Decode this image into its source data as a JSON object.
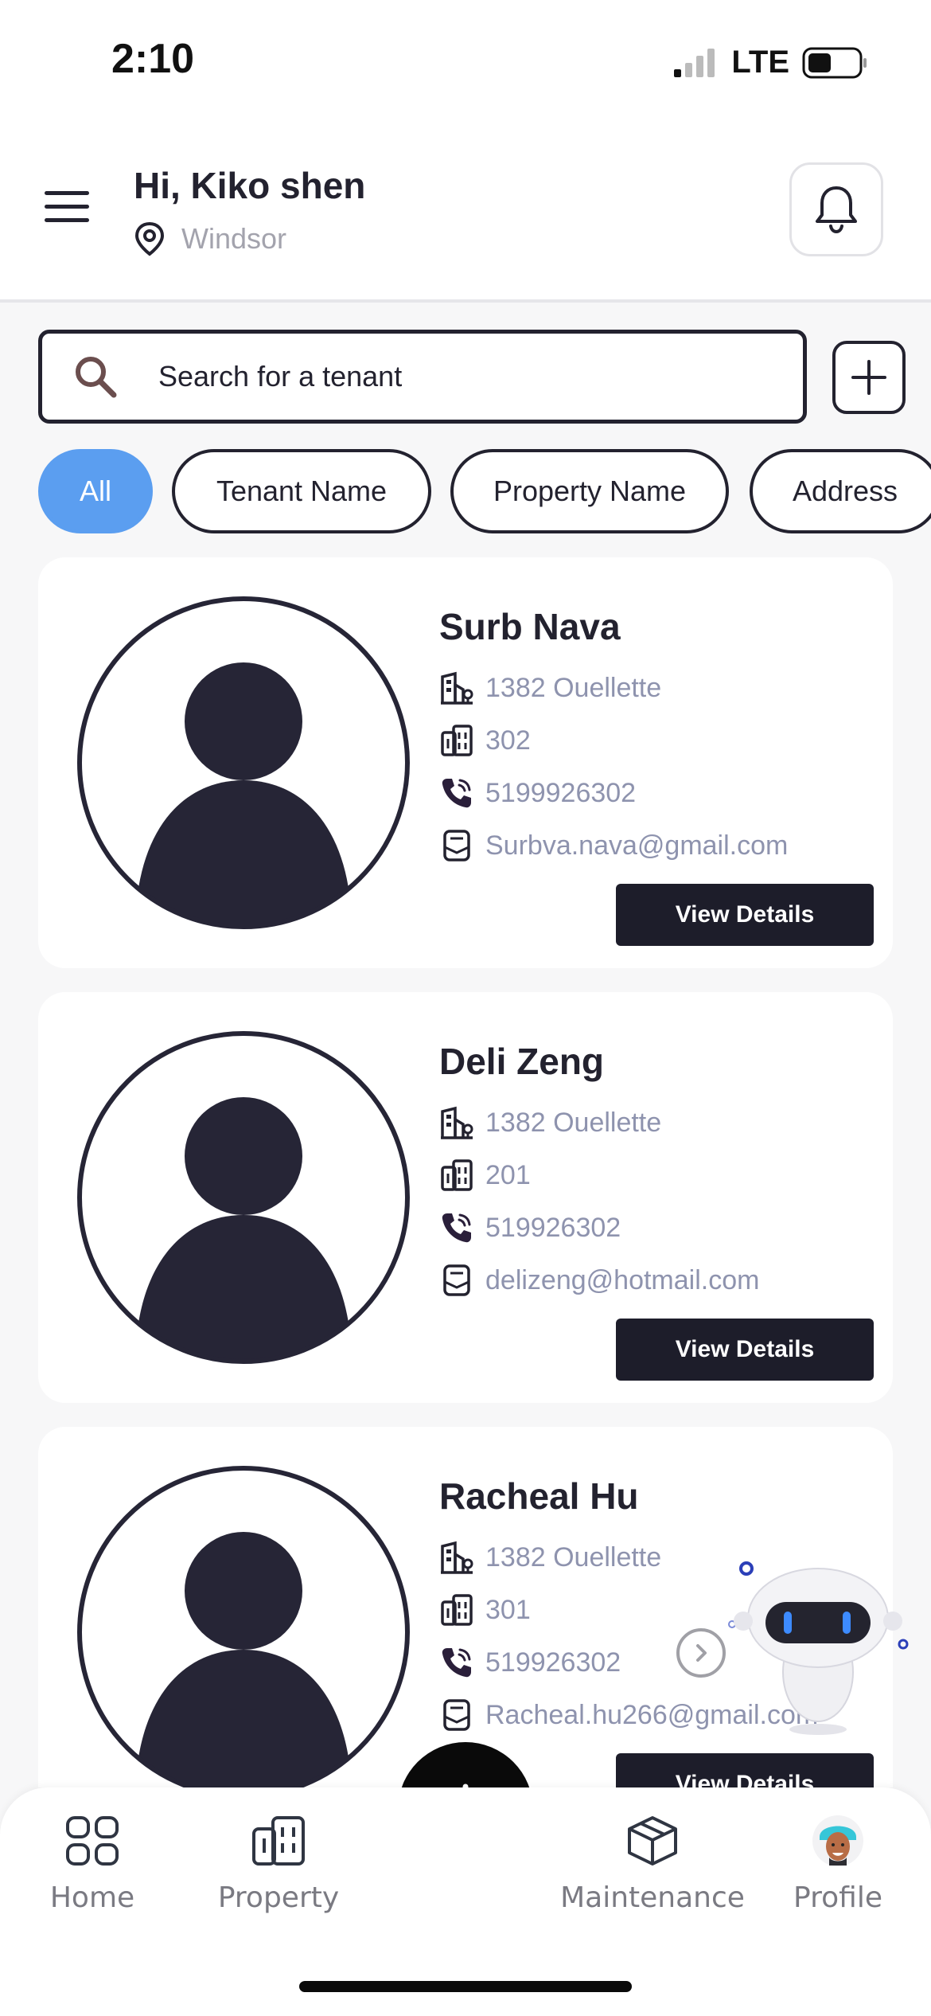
{
  "status": {
    "time": "2:10",
    "network": "LTE"
  },
  "header": {
    "greeting": "Hi, Kiko shen",
    "location": "Windsor"
  },
  "search": {
    "placeholder": "Search for a tenant"
  },
  "filters": [
    "All",
    "Tenant Name",
    "Property Name",
    "Address"
  ],
  "active_filter": "All",
  "tenants": [
    {
      "name": "Surb Nava",
      "address": "1382 Ouellette",
      "unit": "302",
      "phone": "5199926302",
      "email": "Surbva.nava@gmail.com",
      "button": "View Details"
    },
    {
      "name": "Deli Zeng",
      "address": "1382 Ouellette",
      "unit": "201",
      "phone": "519926302",
      "email": "delizeng@hotmail.com",
      "button": "View Details"
    },
    {
      "name": "Racheal Hu",
      "address": "1382 Ouellette",
      "unit": "301",
      "phone": "519926302",
      "email": "Racheal.hu266@gmail.com",
      "button": "View Details"
    }
  ],
  "tabbar": {
    "home": "Home",
    "property": "Property",
    "maintenance": "Maintenance",
    "profile": "Profile"
  },
  "colors": {
    "accent": "#5b9ef0",
    "dark": "#23222f",
    "muted": "#8e93ae"
  },
  "icons": [
    "menu-icon",
    "location-pin-icon",
    "bell-icon",
    "search-icon",
    "plus-icon",
    "building-icon",
    "apartment-icon",
    "phone-icon",
    "email-icon",
    "grid-icon",
    "box-icon",
    "chatbot-icon"
  ]
}
